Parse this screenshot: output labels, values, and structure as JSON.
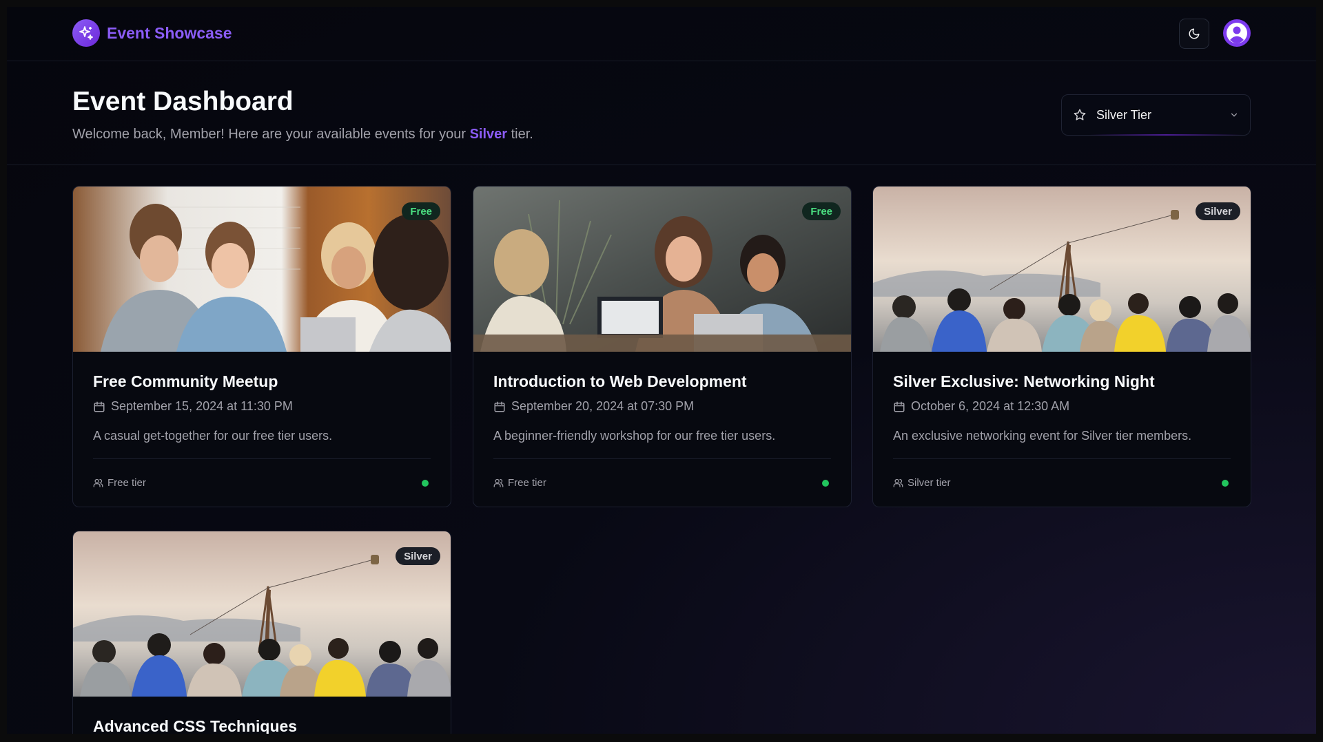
{
  "app": {
    "name": "Event Showcase"
  },
  "header": {
    "theme_icon": "moon-icon",
    "avatar_icon": "user-icon"
  },
  "page": {
    "title": "Event Dashboard",
    "welcome_prefix": "Welcome back, Member! Here are your available events for your",
    "welcome_tier": "Silver",
    "welcome_suffix": "tier."
  },
  "tier_select": {
    "value": "Silver Tier",
    "icon": "star-icon"
  },
  "colors": {
    "accent": "#8b5cf6",
    "status_active": "#22c55e"
  },
  "events": [
    {
      "title": "Free Community Meetup",
      "date": "September 15, 2024 at 11:30 PM",
      "description": "A casual get-together for our free tier users.",
      "badge": "Free",
      "tier": "Free tier",
      "status": "active"
    },
    {
      "title": "Introduction to Web Development",
      "date": "September 20, 2024 at 07:30 PM",
      "description": "A beginner-friendly workshop for our free tier users.",
      "badge": "Free",
      "tier": "Free tier",
      "status": "active"
    },
    {
      "title": "Silver Exclusive: Networking Night",
      "date": "October 6, 2024 at 12:30 AM",
      "description": "An exclusive networking event for Silver tier members.",
      "badge": "Silver",
      "tier": "Silver tier",
      "status": "active"
    },
    {
      "title": "Advanced CSS Techniques",
      "badge": "Silver"
    }
  ]
}
